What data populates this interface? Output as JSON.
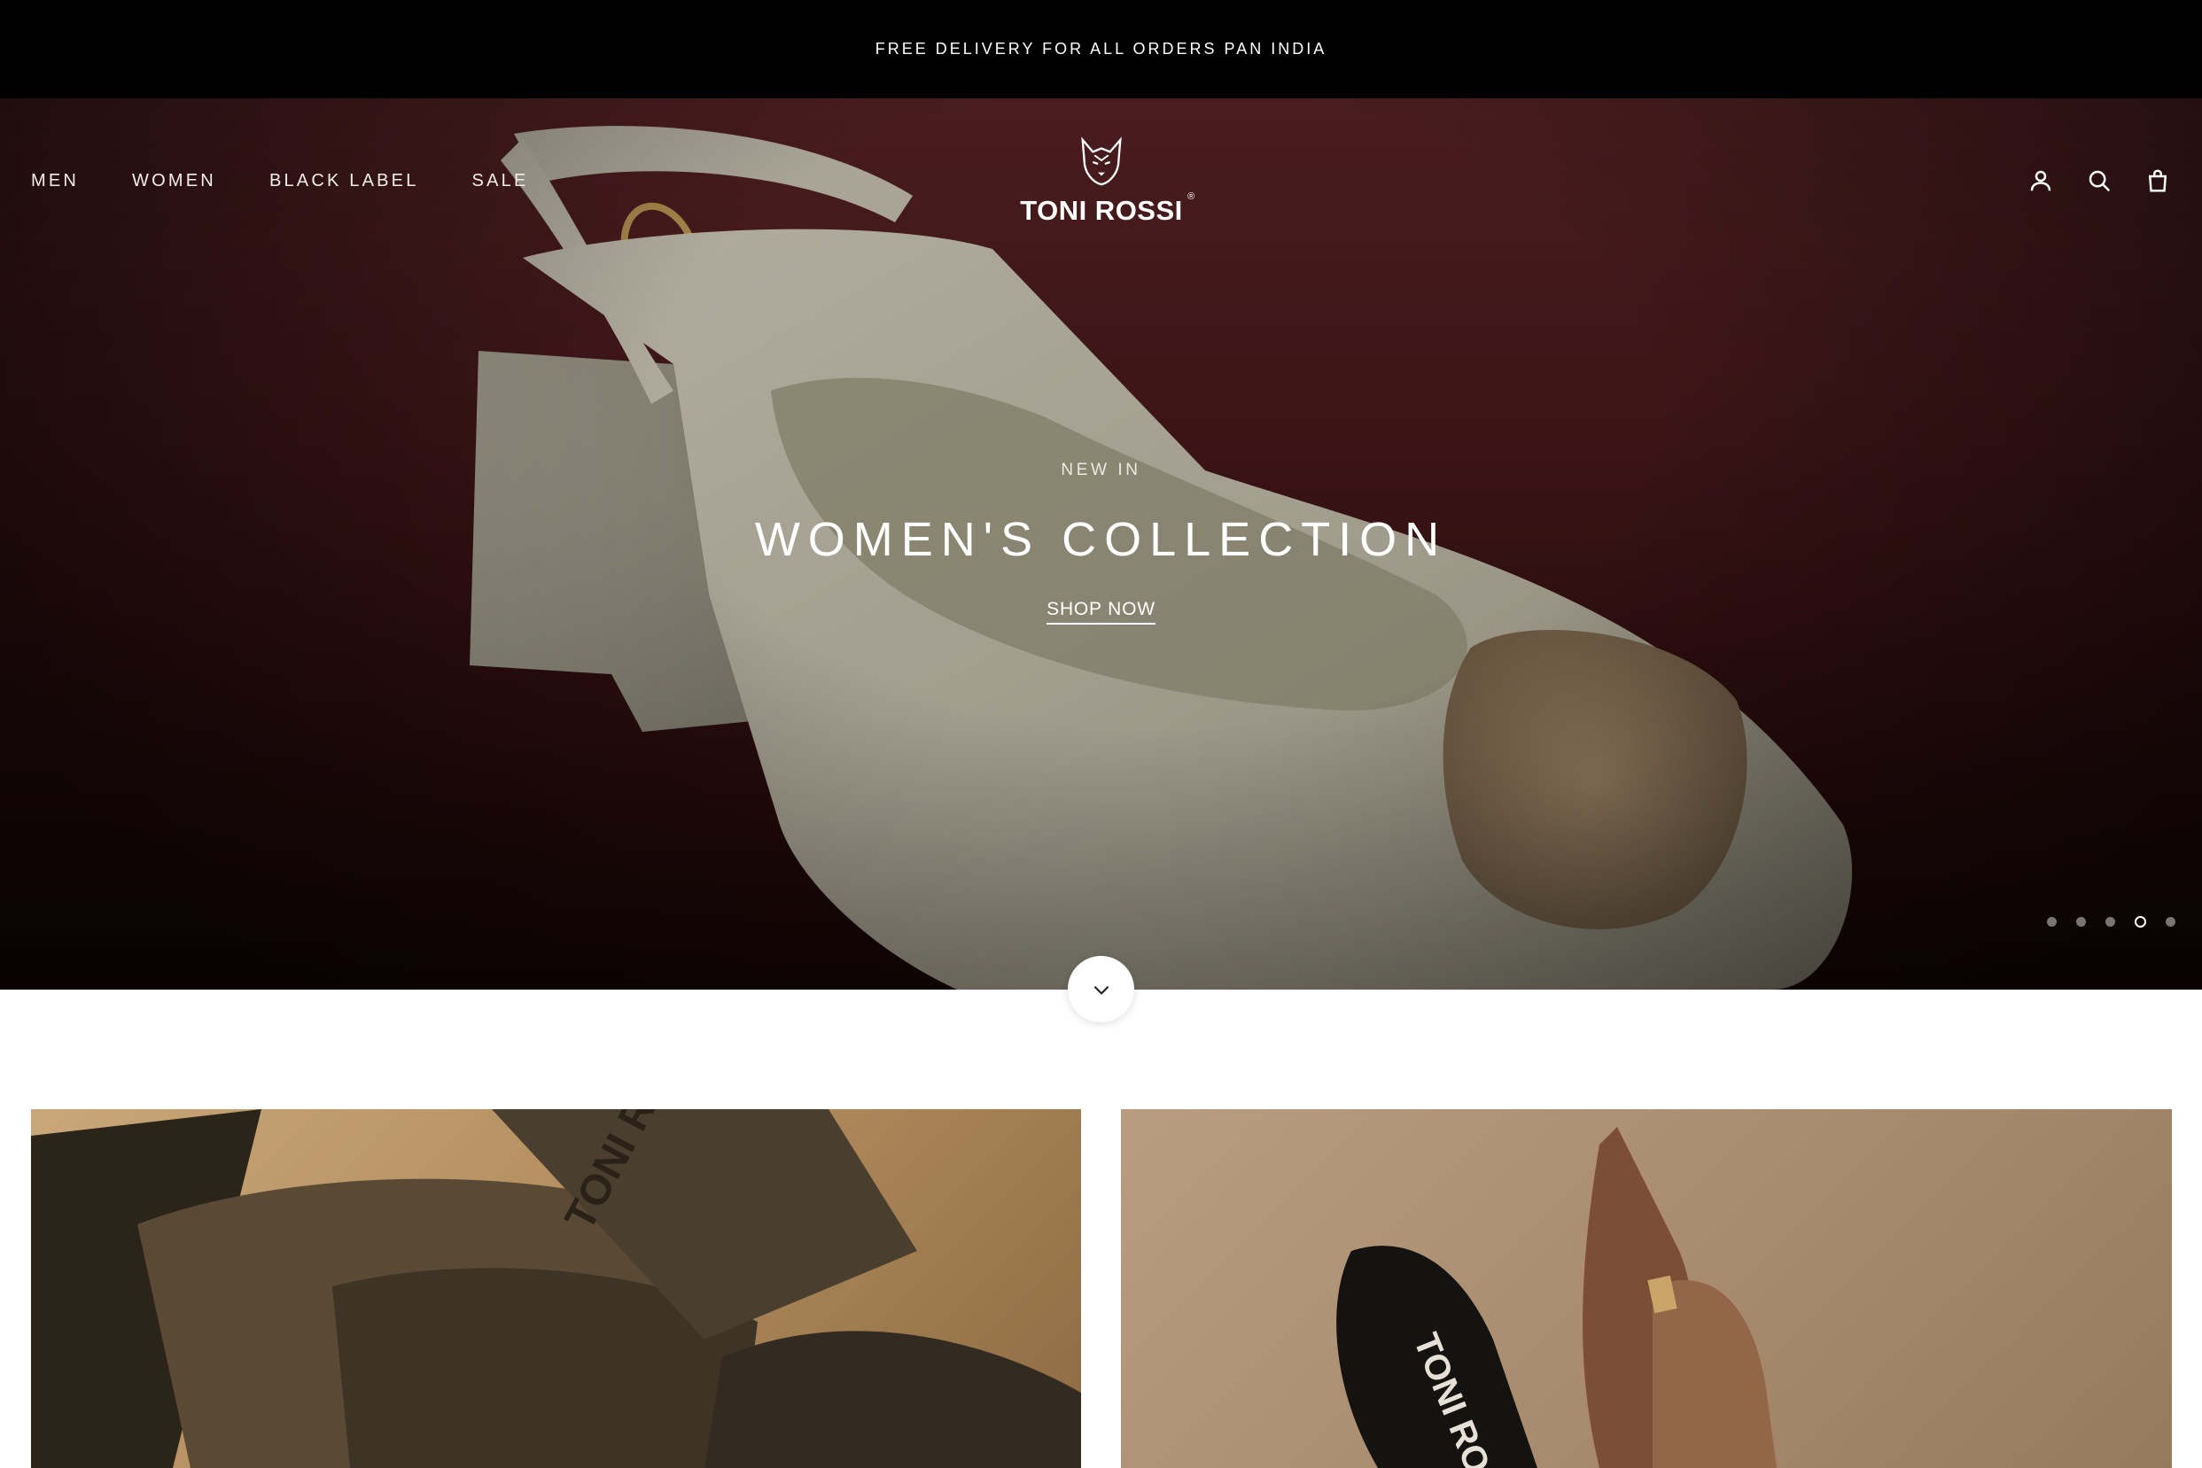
{
  "announcement": "FREE DELIVERY FOR ALL ORDERS PAN INDIA",
  "nav": {
    "left": [
      "MEN",
      "WOMEN",
      "BLACK LABEL",
      "SALE"
    ],
    "logo_text": "TONI ROSSI",
    "logo_reg": "®",
    "right_icons": [
      "account-icon",
      "search-icon",
      "cart-icon"
    ]
  },
  "hero": {
    "eyebrow": "NEW IN",
    "headline": "WOMEN'S COLLECTION",
    "cta": "SHOP NOW",
    "slides_total": 5,
    "slide_active": 4
  },
  "tiles": {
    "left_brand_print": "TONI ROSSI",
    "right_brand_print": "TONI ROSSI"
  },
  "colors": {
    "announcement_bg": "#000000",
    "hero_bg": "#4a1a1d",
    "text_light": "#ffffff"
  }
}
